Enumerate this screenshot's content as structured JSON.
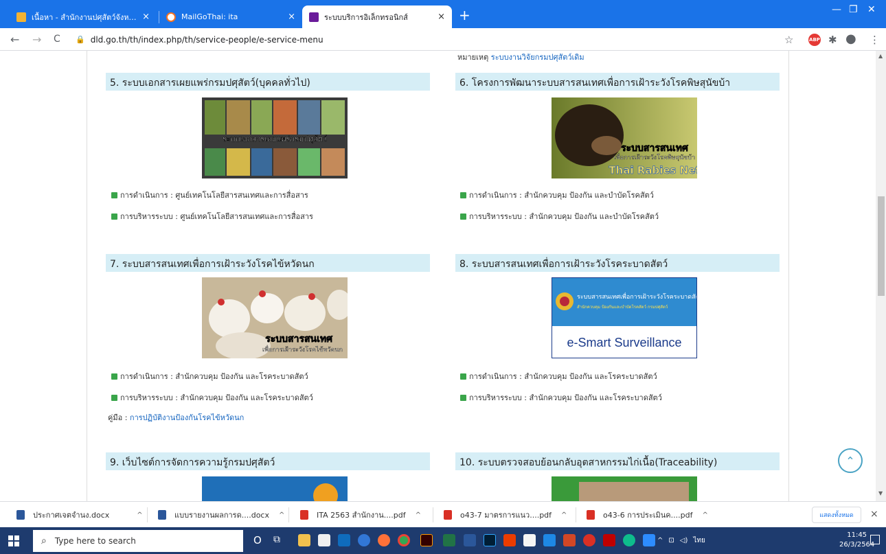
{
  "browser": {
    "tabs": [
      {
        "title": "เนื้อหา - สำนักงานปศุสัตว์จังหวัดนครปฐ",
        "close": "×"
      },
      {
        "title": "MailGoThai: ita",
        "close": "×"
      },
      {
        "title": "ระบบบริการอิเล็กทรอนิกส์",
        "close": "×"
      }
    ],
    "new_tab": "+",
    "window_controls": [
      "—",
      "❐",
      "✕"
    ],
    "back": "←",
    "forward": "→",
    "reload": "C",
    "lock": "🔒",
    "url": "dld.go.th/th/index.php/th/service-people/e-service-menu",
    "star": "☆",
    "abp": "ABP",
    "extensions": "✱",
    "profile": "●",
    "menu": "⋮"
  },
  "page": {
    "note_label": "หมายเหตุ",
    "note_link": "ระบบงานวิจัยกรมปศุสัตว์เดิม",
    "sections": [
      {
        "title": "5. ระบบเอกสารเผยแพร่กรมปศุสัตว์(บุคคลทั่วไป)",
        "banner": "ระบบเอกสารเผยแพร่กรมปศุสัตว์",
        "ops_label": "การดำเนินการ :",
        "ops": "ศูนย์เทคโนโลยีสารสนเทศและการสื่อสาร",
        "admin_label": "การบริหารระบบ :",
        "admin": "ศูนย์เทคโนโลยีสารสนเทศและการสื่อสาร"
      },
      {
        "title": "6. โครงการพัฒนาระบบสารสนเทศเพื่อการเฝ้าระวังโรคพิษสุนัขบ้า",
        "banner_line1": "ระบบสารสนเทศ",
        "banner_line2": "เพื่อการเฝ้าระวังโรคพิษสุนัขบ้า",
        "banner_line3": "Thai Rabies Net",
        "ops_label": "การดำเนินการ :",
        "ops": "สำนักควบคุม ป้องกัน และบำบัดโรคสัตว์",
        "admin_label": "การบริหารระบบ :",
        "admin": "สำนักควบคุม ป้องกัน และบำบัดโรคสัตว์"
      },
      {
        "title": "7. ระบบสารสนเทศเพื่อการเฝ้าระวังโรคไข้หวัดนก",
        "banner_line1": "ระบบสารสนเทศ",
        "banner_line2": "เพื่อการเฝ้าระวังโรคไข้หวัดนก",
        "ops_label": "การดำเนินการ :",
        "ops": "สำนักควบคุม ป้องกัน และโรคระบาดสัตว์",
        "admin_label": "การบริหารระบบ :",
        "admin": "สำนักควบคุม ป้องกัน และโรคระบาดสัตว์",
        "manual_label": "คู่มือ :",
        "manual_link": "การปฏิบัติงานป้องกันโรคไข้หวัดนก"
      },
      {
        "title": "8. ระบบสารสนเทศเพื่อการเฝ้าระวังโรคระบาดสัตว์",
        "banner_line1": "ระบบสารสนเทศเพื่อการเฝ้าระวังโรคระบาดสัตว์",
        "banner_line2": "สำนักควบคุม ป้องกันและบำบัดโรคสัตว์ กรมปศุสัตว์",
        "banner_line3": "e-Smart Surveillance",
        "ops_label": "การดำเนินการ :",
        "ops": "สำนักควบคุม ป้องกัน และโรคระบาดสัตว์",
        "admin_label": "การบริหารระบบ :",
        "admin": "สำนักควบคุม ป้องกัน และโรคระบาดสัตว์"
      },
      {
        "title": "9. เว็บไซต์การจัดการความรู้กรมปศุสัตว์"
      },
      {
        "title": "10. ระบบตรวจสอบย้อนกลับอุตสาหกรรมไก่เนื้อ(Traceability)"
      }
    ],
    "to_top": "⌃"
  },
  "downloads": {
    "items": [
      {
        "name": "ประกาศเจตจำนง.docx",
        "type": "docx"
      },
      {
        "name": "แบบรายงานผลการด....docx",
        "type": "docx"
      },
      {
        "name": "ITA 2563 สำนักงาน....pdf",
        "type": "pdf"
      },
      {
        "name": "o43-7 มาตรการแนว....pdf",
        "type": "pdf"
      },
      {
        "name": "o43-6 การประเมินค....pdf",
        "type": "pdf"
      }
    ],
    "show_all": "แสดงทั้งหมด",
    "close": "×",
    "chevron": "^"
  },
  "taskbar": {
    "search_placeholder": "Type here to search",
    "search_icon": "⌕",
    "cortana": "O",
    "task_view": "⧉",
    "lang": "ไทย",
    "time": "11:45",
    "date": "26/3/2564",
    "tray_up": "^",
    "apps": [
      "file-explorer",
      "store",
      "mail",
      "edge",
      "firefox",
      "chrome",
      "illustrator",
      "excel",
      "word",
      "photoshop",
      "office",
      "files",
      "onedrive",
      "powerpoint",
      "browser",
      "filezilla",
      "edge-new",
      "zoom"
    ],
    "colors": {
      "taskbar": "#1e3b6e",
      "tabstrip": "#1a73e8"
    }
  }
}
